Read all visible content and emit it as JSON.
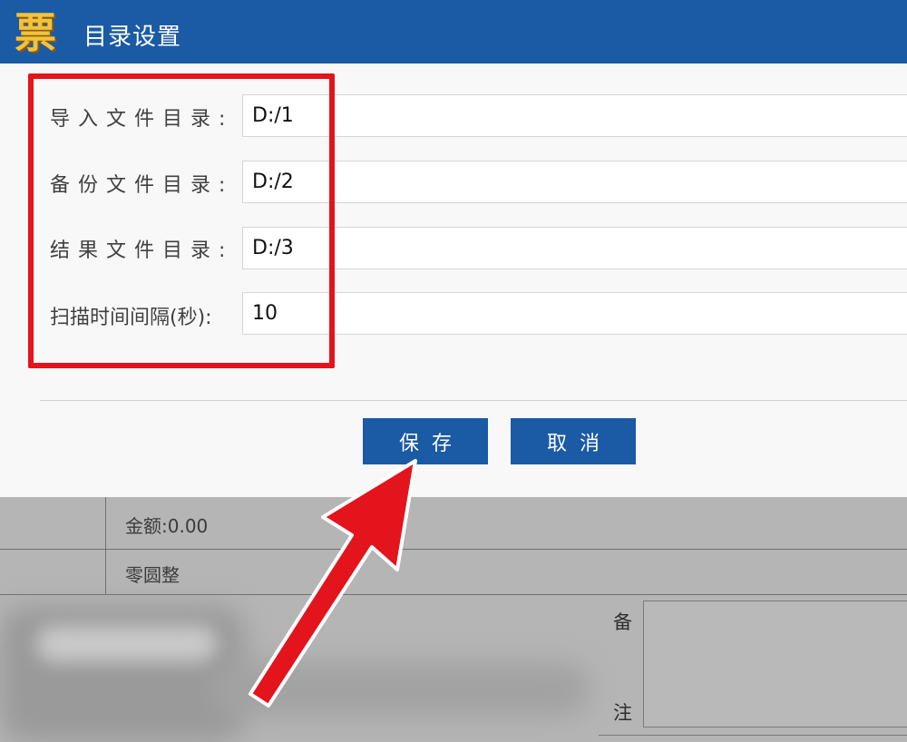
{
  "dialog": {
    "logo_char": "票",
    "title": "目录设置",
    "fields": [
      {
        "label": "导入文件目录:",
        "value": "D:/1"
      },
      {
        "label": "备份文件目录:",
        "value": "D:/2"
      },
      {
        "label": "结果文件目录:",
        "value": "D:/3"
      },
      {
        "label": "扫描时间间隔(秒):",
        "value": "10"
      }
    ],
    "buttons": {
      "save": "保存",
      "cancel": "取消"
    }
  },
  "background": {
    "amount": "金额:0.00",
    "amount_words": "零圆整",
    "note_char_1": "备",
    "note_char_2": "注"
  },
  "colors": {
    "titlebar": "#1b5aa5",
    "button": "#1b5aa5",
    "highlight": "#e3141c",
    "arrow": "#e3141c"
  }
}
